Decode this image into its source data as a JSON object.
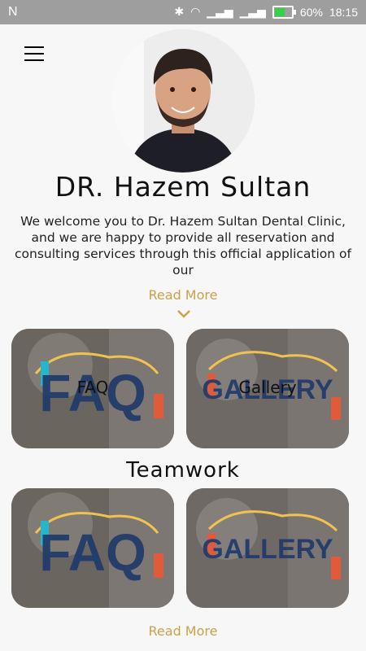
{
  "status_bar": {
    "left_icon": "N",
    "battery": "60%",
    "time": "18:15",
    "battery_color": "#37d04a"
  },
  "header": {
    "doctor_name": "DR. Hazem Sultan"
  },
  "intro": {
    "text": "We welcome you to Dr. Hazem Sultan Dental Clinic, and we are happy to provide all reservation and consulting services through this official application of our"
  },
  "read_more_top": "Read More",
  "cards_row1": [
    {
      "big": "FAQ",
      "label": "FAQ"
    },
    {
      "big": "GALLERY",
      "label": "Gallery"
    }
  ],
  "section_title": "Teamwork",
  "cards_row2": [
    {
      "big": "FAQ",
      "label": ""
    },
    {
      "big": "GALLERY",
      "label": ""
    }
  ],
  "read_more_bottom": "Read More",
  "colors": {
    "accent": "#c9a24a",
    "card_text_big": "#203a6b",
    "status_bar": "#9e9e9e"
  },
  "icons": {
    "menu": "hamburger-icon",
    "chevron": "chevron-down-icon"
  }
}
